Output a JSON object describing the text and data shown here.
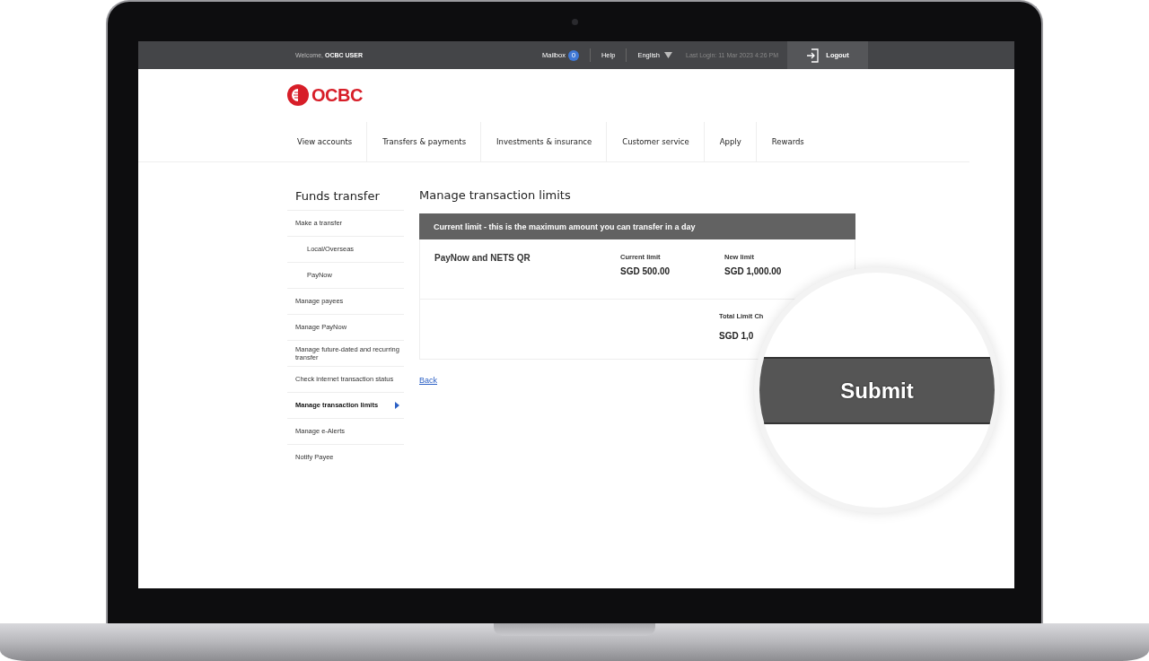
{
  "topbar": {
    "welcome": "Welcome,",
    "user": "OCBC USER",
    "mailbox": "Mailbox",
    "mailbox_count": "0",
    "help": "Help",
    "language": "English",
    "last_login": "Last Login: 11 Mar 2023 4:26 PM",
    "logout": "Logout"
  },
  "logo": "OCBC",
  "nav": [
    {
      "label": "View accounts"
    },
    {
      "label": "Transfers & payments"
    },
    {
      "label": "Investments & insurance"
    },
    {
      "label": "Customer service"
    },
    {
      "label": "Apply"
    },
    {
      "label": "Rewards"
    }
  ],
  "sidebar": {
    "title": "Funds transfer",
    "items": [
      {
        "label": "Make a transfer",
        "selected": false,
        "children": [
          {
            "label": "Local/Overseas",
            "selected": false
          },
          {
            "label": "PayNow",
            "selected": false
          }
        ]
      },
      {
        "label": "Manage payees",
        "selected": false
      },
      {
        "label": "Manage PayNow",
        "selected": false
      },
      {
        "label": "Manage future-dated and recurring transfer",
        "selected": false
      },
      {
        "label": "Check internet transaction status",
        "selected": false
      },
      {
        "label": "Manage transaction limits",
        "selected": true
      },
      {
        "label": "Manage e-Alerts",
        "selected": false
      },
      {
        "label": "Notify Payee",
        "selected": false
      }
    ]
  },
  "main": {
    "title": "Manage transaction limits",
    "banner": "Current limit - this is the maximum amount you can transfer in a day",
    "limit": {
      "name": "PayNow and NETS QR",
      "current_label": "Current limit",
      "current_value": "SGD 500.00",
      "new_label": "New limit",
      "new_value": "SGD 1,000.00"
    },
    "total": {
      "label": "Total Limit Ch",
      "value": "SGD 1,0"
    },
    "back": "Back"
  },
  "magnifier": {
    "button": "Submit"
  }
}
